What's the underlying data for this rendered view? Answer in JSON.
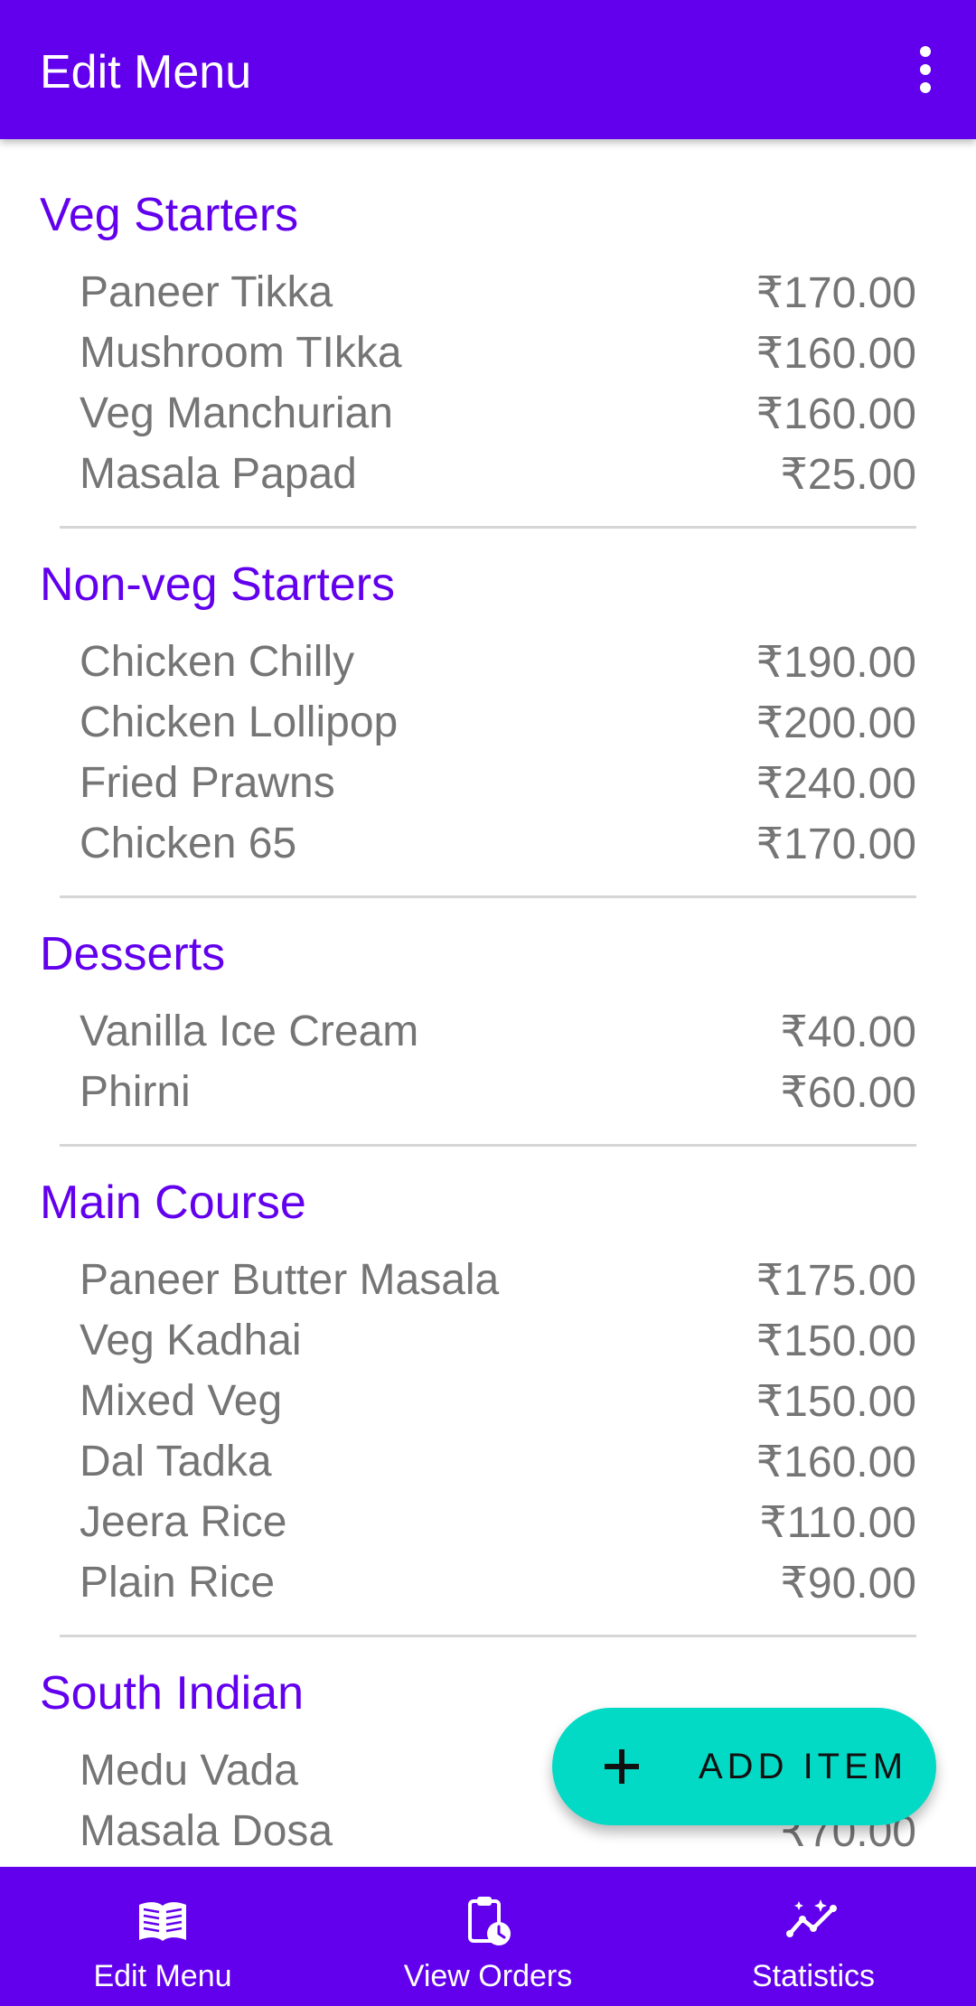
{
  "appbar": {
    "title": "Edit Menu",
    "overflow_icon": "more-vert-icon"
  },
  "categories": [
    {
      "name": "Veg Starters",
      "items": [
        {
          "name": "Paneer Tikka",
          "price": "₹170.00"
        },
        {
          "name": "Mushroom TIkka",
          "price": "₹160.00"
        },
        {
          "name": "Veg Manchurian",
          "price": "₹160.00"
        },
        {
          "name": "Masala Papad",
          "price": "₹25.00"
        }
      ]
    },
    {
      "name": "Non-veg Starters",
      "items": [
        {
          "name": "Chicken Chilly",
          "price": "₹190.00"
        },
        {
          "name": "Chicken Lollipop",
          "price": "₹200.00"
        },
        {
          "name": "Fried Prawns",
          "price": "₹240.00"
        },
        {
          "name": "Chicken 65",
          "price": "₹170.00"
        }
      ]
    },
    {
      "name": "Desserts",
      "items": [
        {
          "name": "Vanilla Ice Cream",
          "price": "₹40.00"
        },
        {
          "name": "Phirni",
          "price": "₹60.00"
        }
      ]
    },
    {
      "name": "Main Course",
      "items": [
        {
          "name": "Paneer Butter Masala",
          "price": "₹175.00"
        },
        {
          "name": "Veg Kadhai",
          "price": "₹150.00"
        },
        {
          "name": "Mixed Veg",
          "price": "₹150.00"
        },
        {
          "name": "Dal Tadka",
          "price": "₹160.00"
        },
        {
          "name": "Jeera Rice",
          "price": "₹110.00"
        },
        {
          "name": "Plain Rice",
          "price": "₹90.00"
        }
      ]
    },
    {
      "name": "South Indian",
      "items": [
        {
          "name": "Medu Vada",
          "price": ""
        },
        {
          "name": "Masala Dosa",
          "price": "₹70.00"
        }
      ]
    }
  ],
  "fab": {
    "label": "ADD ITEM",
    "icon": "plus-icon"
  },
  "bottom_nav": [
    {
      "label": "Edit Menu",
      "icon": "menu-book-icon"
    },
    {
      "label": "View Orders",
      "icon": "clipboard-clock-icon"
    },
    {
      "label": "Statistics",
      "icon": "insights-icon"
    }
  ],
  "colors": {
    "primary": "#6200ee",
    "accent": "#03dac5",
    "item_text": "#757575"
  }
}
